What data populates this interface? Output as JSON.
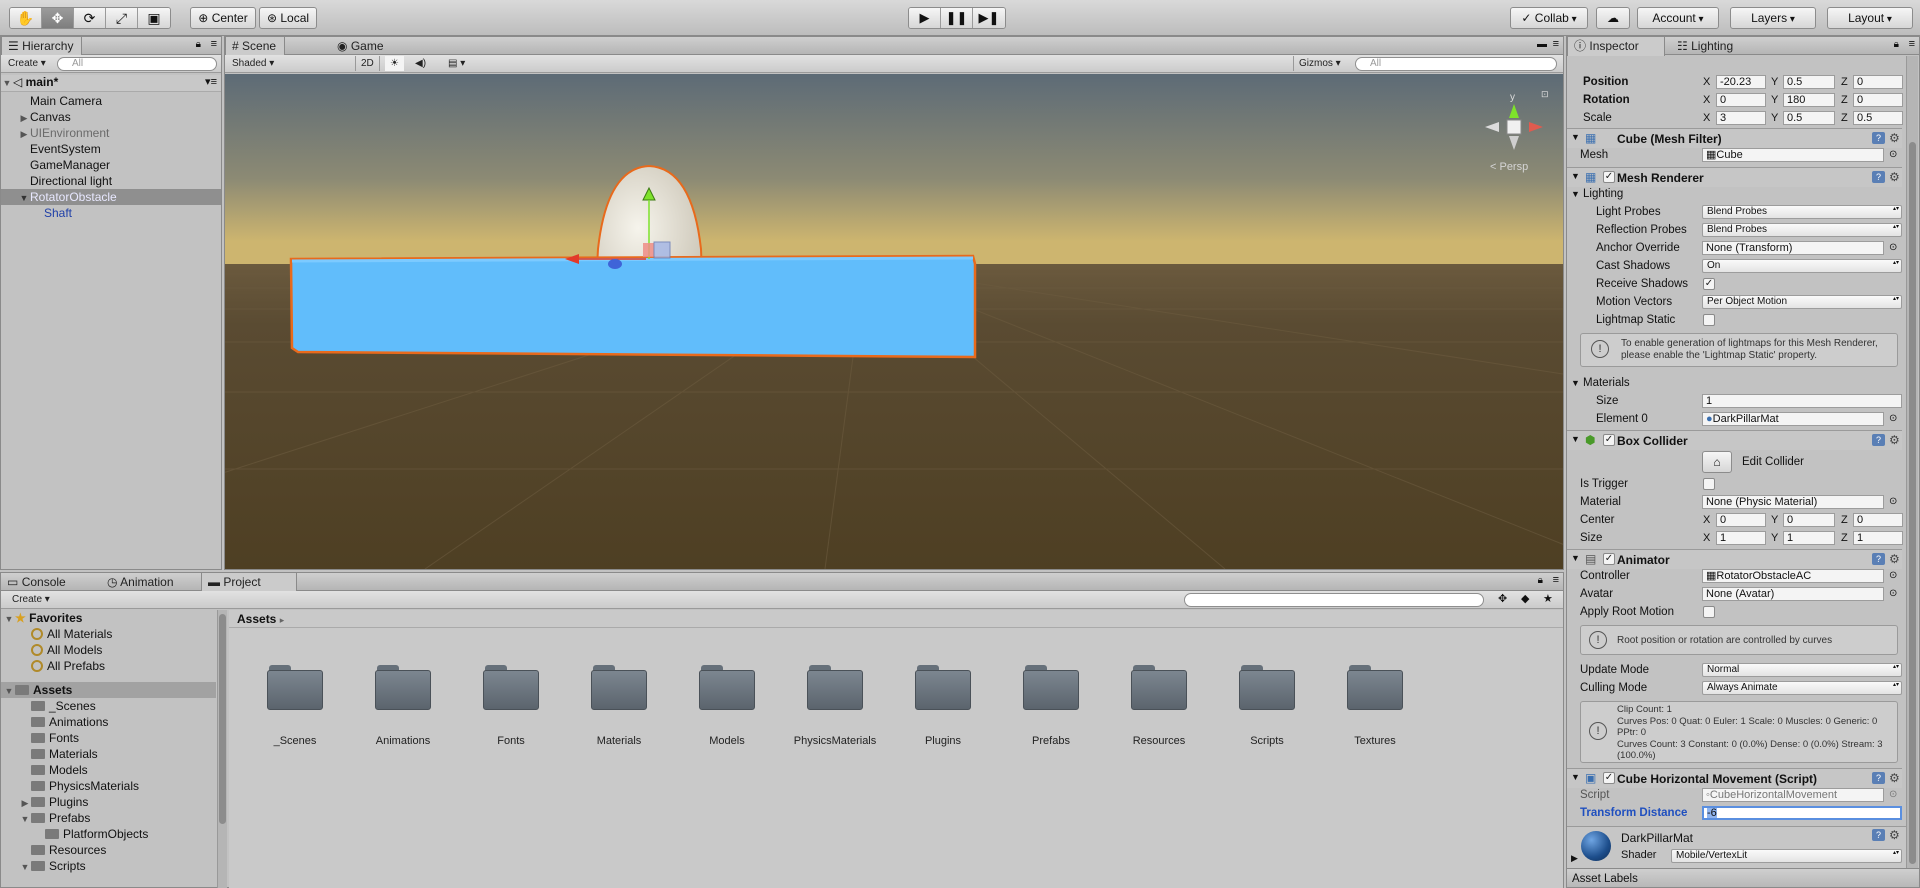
{
  "toolbar": {
    "tools": [
      "hand-tool",
      "move-tool",
      "rotate-tool",
      "scale-tool",
      "rect-tool"
    ],
    "pivot": "Center",
    "space": "Local",
    "collab": "Collab",
    "account": "Account",
    "layers": "Layers",
    "layout": "Layout"
  },
  "hierarchy": {
    "tab": "Hierarchy",
    "create": "Create",
    "search_placeholder": "All",
    "scene": "main*",
    "items": [
      "Main Camera",
      "Canvas",
      "UIEnvironment",
      "EventSystem",
      "GameManager",
      "Directional light",
      "RotatorObstacle",
      "Shaft"
    ]
  },
  "scene": {
    "tabs": [
      "Scene",
      "Game"
    ],
    "shading": "Shaded",
    "mode2d": "2D",
    "gizmos": "Gizmos",
    "search_placeholder": "All",
    "persp": "< Persp",
    "gizmo_y": "y"
  },
  "bottom": {
    "tabs": [
      "Console",
      "Animation",
      "Project"
    ],
    "create": "Create",
    "breadcrumb": "Assets",
    "favorites": {
      "label": "Favorites",
      "items": [
        "All Materials",
        "All Models",
        "All Prefabs"
      ]
    },
    "assets": {
      "label": "Assets",
      "items": [
        "_Scenes",
        "Animations",
        "Fonts",
        "Materials",
        "Models",
        "PhysicsMaterials",
        "Plugins",
        "Prefabs",
        "PlatformObjects",
        "Resources",
        "Scripts"
      ]
    },
    "folders": [
      "_Scenes",
      "Animations",
      "Fonts",
      "Materials",
      "Models",
      "PhysicsMaterials",
      "Plugins",
      "Prefabs",
      "Resources",
      "Scripts",
      "Textures"
    ]
  },
  "inspector": {
    "tabs": [
      "Inspector",
      "Lighting"
    ],
    "transform": {
      "position": {
        "label": "Position",
        "x": "-20.23",
        "y": "0.5",
        "z": "0"
      },
      "rotation": {
        "label": "Rotation",
        "x": "0",
        "y": "180",
        "z": "0"
      },
      "scale": {
        "label": "Scale",
        "x": "3",
        "y": "0.5",
        "z": "0.5"
      }
    },
    "mesh_filter": {
      "title": "Cube (Mesh Filter)",
      "mesh_label": "Mesh",
      "mesh": "Cube"
    },
    "mesh_renderer": {
      "title": "Mesh Renderer",
      "lighting": "Lighting",
      "light_probes_label": "Light Probes",
      "light_probes": "Blend Probes",
      "reflection_label": "Reflection Probes",
      "reflection": "Blend Probes",
      "anchor_label": "Anchor Override",
      "anchor": "None (Transform)",
      "cast_label": "Cast Shadows",
      "cast": "On",
      "receive_label": "Receive Shadows",
      "motion_label": "Motion Vectors",
      "motion": "Per Object Motion",
      "lightmap_label": "Lightmap Static",
      "help": "To enable generation of lightmaps for this Mesh Renderer, please enable the 'Lightmap Static' property.",
      "materials": "Materials",
      "size_label": "Size",
      "size": "1",
      "element_label": "Element 0",
      "element": "DarkPillarMat"
    },
    "box_collider": {
      "title": "Box Collider",
      "edit": "Edit Collider",
      "trigger_label": "Is Trigger",
      "material_label": "Material",
      "material": "None (Physic Material)",
      "center": {
        "label": "Center",
        "x": "0",
        "y": "0",
        "z": "0"
      },
      "size": {
        "label": "Size",
        "x": "1",
        "y": "1",
        "z": "1"
      }
    },
    "animator": {
      "title": "Animator",
      "controller_label": "Controller",
      "controller": "RotatorObstacleAC",
      "avatar_label": "Avatar",
      "avatar": "None (Avatar)",
      "root_label": "Apply Root Motion",
      "help": "Root position or rotation are controlled by curves",
      "update_label": "Update Mode",
      "update": "Normal",
      "culling_label": "Culling Mode",
      "culling": "Always Animate",
      "info1": "Clip Count: 1",
      "info2": "Curves Pos: 0 Quat: 0 Euler: 1 Scale: 0 Muscles: 0 Generic: 0",
      "info3": "PPtr: 0",
      "info4": "Curves Count: 3 Constant: 0 (0.0%) Dense: 0 (0.0%) Stream: 3",
      "info5": "(100.0%)"
    },
    "script": {
      "title": "Cube Horizontal Movement (Script)",
      "script_label": "Script",
      "script": "CubeHorizontalMovement",
      "distance_label": "Transform Distance",
      "distance": "-6"
    },
    "material": {
      "name": "DarkPillarMat",
      "shader_label": "Shader",
      "shader": "Mobile/VertexLit"
    },
    "asset_labels": "Asset Labels",
    "axes": {
      "x": "X",
      "y": "Y",
      "z": "Z"
    }
  }
}
